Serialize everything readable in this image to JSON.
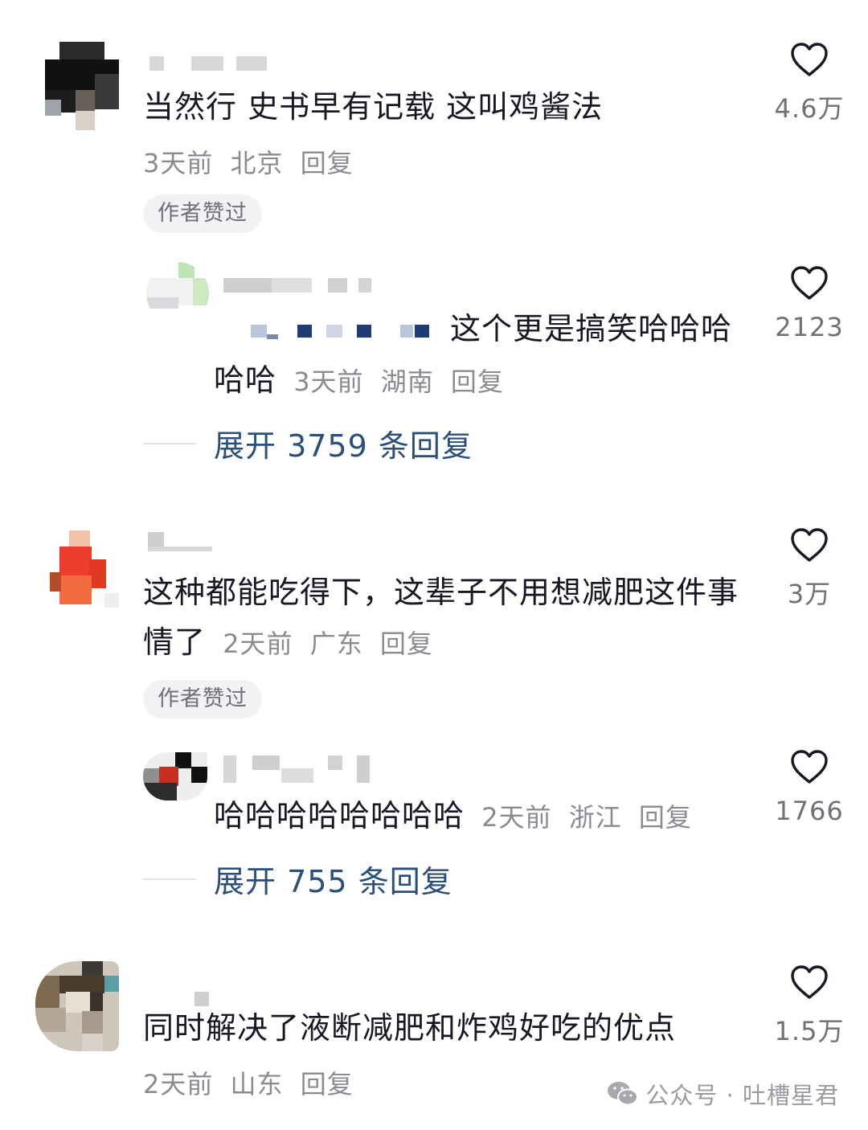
{
  "comments": [
    {
      "text": "当然行 史书早有记载 这叫鸡酱法",
      "time": "3天前",
      "location": "北京",
      "reply_label": "回复",
      "badge": "作者赞过",
      "likes": "4.6万",
      "replies": [
        {
          "text_line1": "这个更是搞笑哈哈哈",
          "text_line2": "哈哈",
          "time": "3天前",
          "location": "湖南",
          "reply_label": "回复",
          "likes": "2123"
        }
      ],
      "expand_label": "展开 3759 条回复"
    },
    {
      "text_line1": "这种都能吃得下，这辈子不用想减肥这件事",
      "text_line2": "情了",
      "time": "2天前",
      "location": "广东",
      "reply_label": "回复",
      "badge": "作者赞过",
      "likes": "3万",
      "replies": [
        {
          "text": "哈哈哈哈哈哈哈哈",
          "time": "2天前",
          "location": "浙江",
          "reply_label": "回复",
          "likes": "1766"
        }
      ],
      "expand_label": "展开 755 条回复"
    },
    {
      "text": "同时解决了液断减肥和炸鸡好吃的优点",
      "time": "2天前",
      "location": "山东",
      "reply_label": "回复",
      "likes": "1.5万"
    }
  ],
  "watermark": {
    "icon": "wechat-icon",
    "text": "公众号 · 吐槽星君"
  },
  "colors": {
    "text": "#161823",
    "meta": "#8a8b91",
    "link": "#2a4f7a",
    "badge_bg": "#f2f2f4"
  }
}
